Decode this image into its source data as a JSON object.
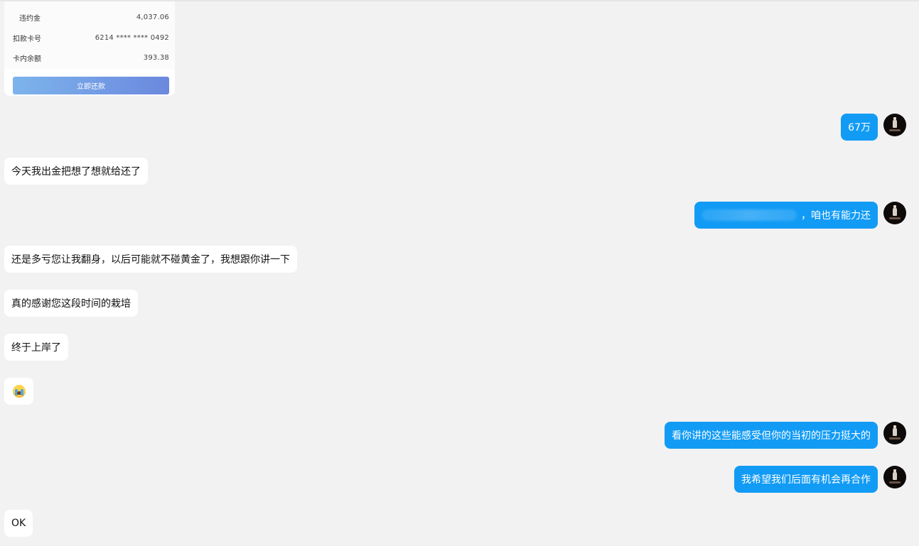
{
  "loan_card": {
    "rows": [
      {
        "label": "违约金",
        "value": "4,037.06"
      },
      {
        "label": "扣款卡号",
        "value": "6214 **** **** 0492"
      },
      {
        "label": "卡内余额",
        "value": "393.38"
      }
    ],
    "button_label": "立即还款"
  },
  "messages": [
    {
      "side": "out",
      "text": "67万"
    },
    {
      "side": "in",
      "text": "今天我出金把想了想就给还了"
    },
    {
      "side": "out",
      "text": "，咱也有能力还"
    },
    {
      "side": "in",
      "text": "还是多亏您让我翻身，以后可能就不碰黄金了，我想跟你讲一下"
    },
    {
      "side": "in",
      "text": "真的感谢您这段时间的栽培"
    },
    {
      "side": "in",
      "text": "终于上岸了"
    },
    {
      "side": "in",
      "emoji": "crying-face-emoji"
    },
    {
      "side": "out",
      "text": "看你讲的这些能感受但你的当初的压力挺大的"
    },
    {
      "side": "out",
      "text": "我希望我们后面有机会再合作"
    },
    {
      "side": "in",
      "text": "OK"
    }
  ],
  "colors": {
    "background": "#f2f2f2",
    "incoming_bubble": "#ffffff",
    "outgoing_bubble": "#129bf5",
    "button_gradient_start": "#7db4ec",
    "button_gradient_end": "#6b88de"
  }
}
